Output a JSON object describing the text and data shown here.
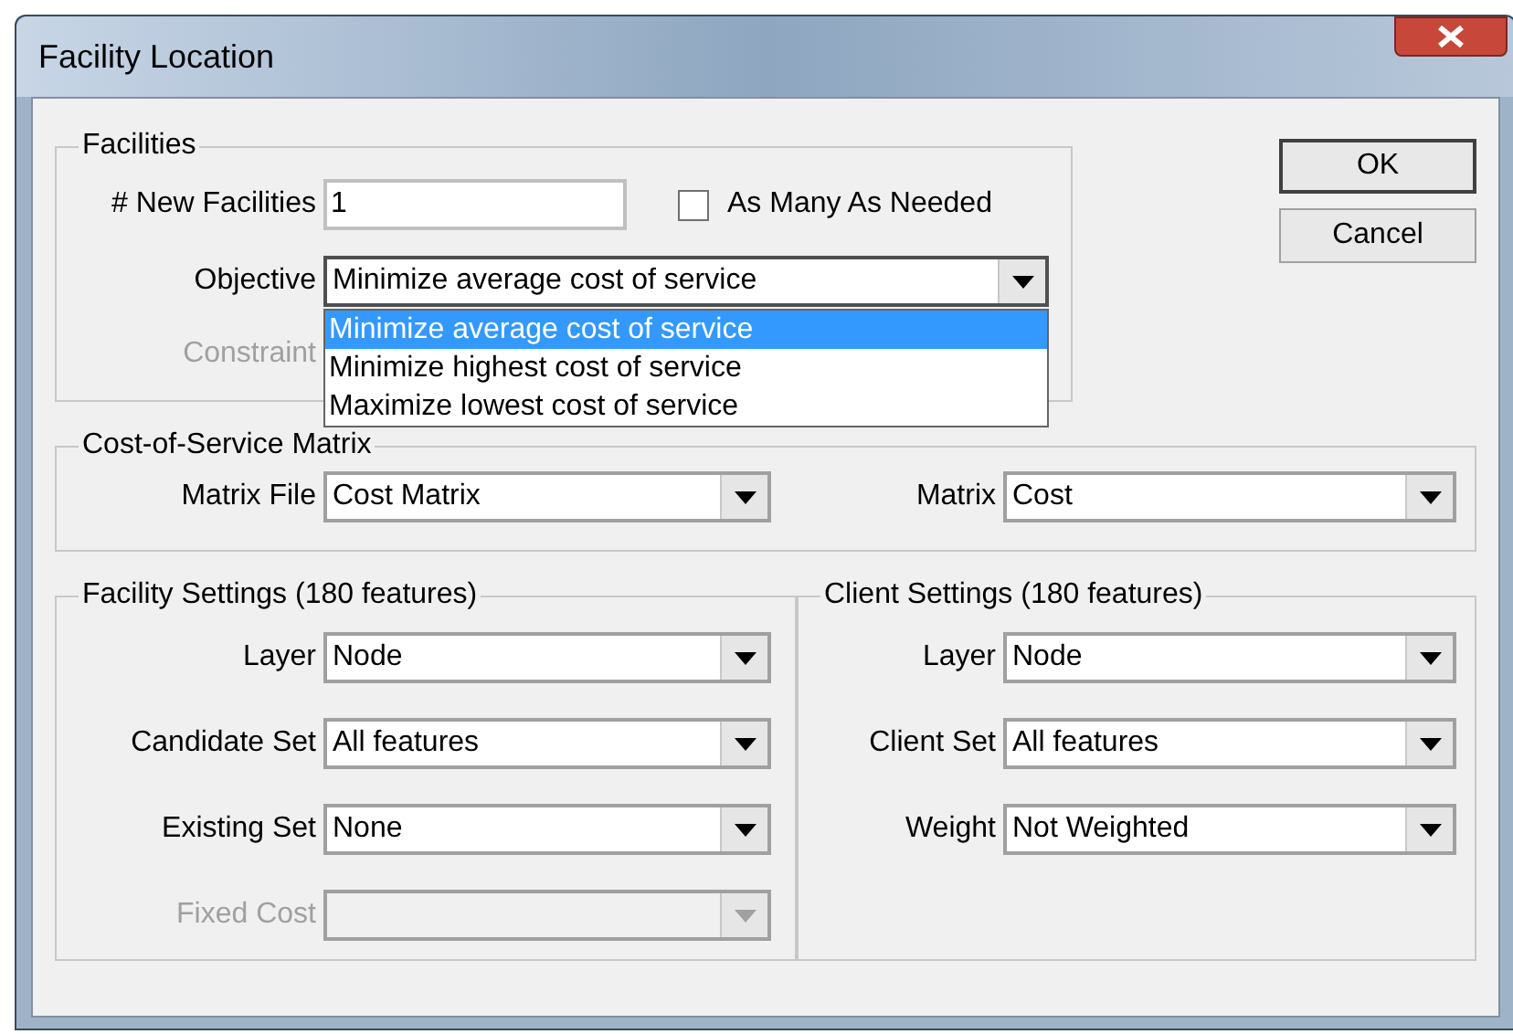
{
  "window": {
    "title": "Facility Location"
  },
  "buttons": [
    {
      "label": "OK",
      "default": true
    },
    {
      "label": "Cancel",
      "default": false
    }
  ],
  "facilities": {
    "title": "Facilities",
    "new_facilities": {
      "label": "# New Facilities",
      "value": "1"
    },
    "as_many_as_needed": {
      "label": "As Many As Needed",
      "checked": false
    },
    "objective": {
      "label": "Objective",
      "value": "Minimize average cost of service",
      "expanded": true,
      "options": [
        {
          "label": "Minimize average cost of service",
          "selected": true
        },
        {
          "label": "Minimize highest cost of service",
          "selected": false
        },
        {
          "label": "Maximize lowest cost of service",
          "selected": false
        }
      ]
    },
    "constraint": {
      "label": "Constraint",
      "disabled": true
    }
  },
  "matrix": {
    "title": "Cost-of-Service Matrix",
    "fields": [
      {
        "label": "Matrix File",
        "value": "Cost Matrix",
        "disabled": false
      },
      {
        "label": "Matrix",
        "value": "Cost",
        "disabled": false
      }
    ]
  },
  "facility_settings": {
    "title": "Facility Settings (180 features)",
    "fields": [
      {
        "label": "Layer",
        "value": "Node",
        "disabled": false
      },
      {
        "label": "Candidate Set",
        "value": "All features",
        "disabled": false
      },
      {
        "label": "Existing Set",
        "value": "None",
        "disabled": false
      },
      {
        "label": "Fixed Cost",
        "disabled": true
      }
    ]
  },
  "client_settings": {
    "title": "Client Settings (180 features)",
    "fields": [
      {
        "label": "Layer",
        "value": "Node",
        "disabled": false
      },
      {
        "label": "Client Set",
        "value": "All features",
        "disabled": false
      },
      {
        "label": "Weight",
        "value": "Not Weighted",
        "disabled": false
      }
    ]
  }
}
